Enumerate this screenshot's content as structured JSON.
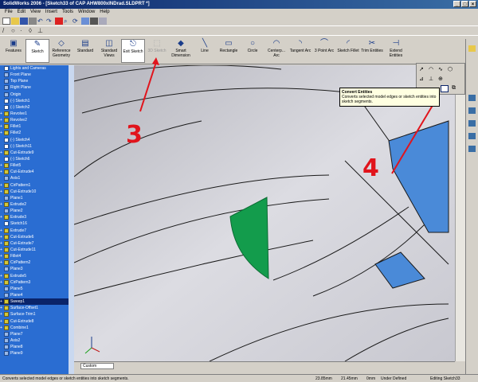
{
  "window": {
    "title": "SolidWorks 2006 - [Sketch33 of CAP AHW800xINDrad.SLDPRT *]"
  },
  "menu": [
    "File",
    "Edit",
    "View",
    "Insert",
    "Tools",
    "Window",
    "Help"
  ],
  "command_manager": [
    {
      "label": "Features"
    },
    {
      "label": "Sketch"
    },
    {
      "label": "Reference Geometry"
    },
    {
      "label": "Standard"
    },
    {
      "label": "Standard Views"
    },
    {
      "label": "Exit Sketch"
    },
    {
      "label": "3D Sketch"
    },
    {
      "label": "Smart Dimension"
    },
    {
      "label": "Line"
    },
    {
      "label": "Rectangle"
    },
    {
      "label": "Circle"
    },
    {
      "label": "Centerp... Arc"
    },
    {
      "label": "Tangent Arc"
    },
    {
      "label": "3 Point Arc"
    },
    {
      "label": "Sketch Fillet"
    },
    {
      "label": "Trim Entities"
    },
    {
      "label": "Extend Entities"
    }
  ],
  "feature_tree": [
    "Lights and Cameras",
    "Front Plane",
    "Top Plane",
    "Right Plane",
    "Origin",
    "(-) Sketch1",
    "(-) Sketch2",
    "Revolve1",
    "Revolve2",
    "Fillet1",
    "Fillet2",
    "(-) Sketch4",
    "(-) Sketch11",
    "Cut-Extrude9",
    "(-) Sketch6",
    "Fillet5",
    "Cut-Extrude4",
    "Axis1",
    "CirPattern1",
    "Cut-Extrude10",
    "Plane1",
    "Extrude2",
    "Plane2",
    "Extrude3",
    "Sketch16",
    "Extrude7",
    "Cut-Extrude6",
    "Cut-Extrude7",
    "Cut-Extrude11",
    "Fillet4",
    "CirPattern2",
    "Plane3",
    "Extrude5",
    "CirPattern3",
    "Plane5",
    "Plane4",
    "Sweep1",
    "Surface-Offset1",
    "Surface-Trim1",
    "Cut-Extrude8",
    "Combine1",
    "Plane7",
    "Axis2",
    "Plane8",
    "Plane9"
  ],
  "tooltip": {
    "title": "Convert Entities",
    "text": "Converts selected model edges or sketch entities into sketch segments."
  },
  "bottom": {
    "combo_value": "Custom"
  },
  "status": {
    "message": "Converts selected model edges or sketch entities into sketch segments.",
    "x": "23.85mm",
    "y": "21.45mm",
    "z": "0mm",
    "state": "Under Defined",
    "editing": "Editing Sketch33"
  },
  "annotations": {
    "a3": "3",
    "a4": "4"
  },
  "colors": {
    "tree_bg": "#2a6dd2",
    "face_fill": "#139c4c",
    "annotation": "#e1141c",
    "viewport_bg": "#d7d7dc"
  }
}
